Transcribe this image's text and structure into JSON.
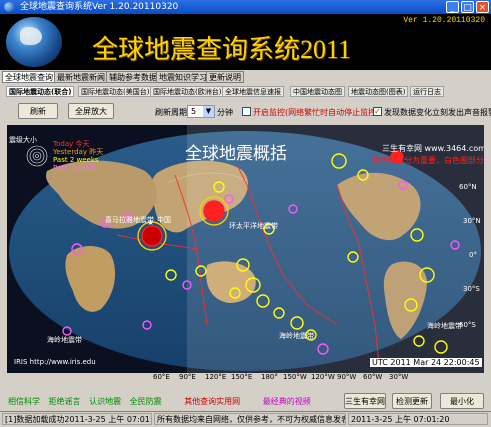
{
  "window": {
    "title": "全球地震查询系统Ver 1.20.20110320",
    "minimize": "_",
    "maximize": "□",
    "close": "×"
  },
  "banner": {
    "title": "全球地震查询系统2011",
    "version": "Ver 1.20.20110320"
  },
  "main_tabs": [
    "全球地震查询",
    "最新地震新闻",
    "辅助参考数据",
    "地震知识学习",
    "更新说明"
  ],
  "sub_tabs": [
    "国际地震动态(联合)",
    "国际地震动态(美国台)",
    "国际地震动态(欧洲台)",
    "全球地震信息速报",
    "中国地震动态图",
    "地震动态图(图表)",
    "运行日志"
  ],
  "toolbar": {
    "refresh": "刷新",
    "fullscreen": "全屏放大",
    "refresh_period_label": "刷新周期",
    "refresh_period_value": "5",
    "refresh_period_unit": "分钟",
    "monitor_label": "开启监控(网络繁忙时自动停止监控)",
    "monitor_checked": false,
    "alarm_label": "发现数据变化立刻发出声音报警",
    "alarm_checked": true
  },
  "map": {
    "title": "全球地震概括",
    "site": "三生有幸网 www.3464.com",
    "note": "黄色圈部分为重要，白色圈部分为白天",
    "legend_size_label": "震级大小",
    "legend": [
      {
        "label": "Today 今天",
        "color": "#ff3030"
      },
      {
        "label": "Yesterday 昨天",
        "color": "#ff9c00"
      },
      {
        "label": "Past 2 weeks",
        "color": "#ffff00"
      },
      {
        "label": "Past 5 years",
        "color": "#ff66ff"
      }
    ],
    "labels": {
      "china": "中国",
      "pacific": "环太平洋地震带",
      "mid_asia": "喜马拉雅地震带",
      "ocean_ridge_1": "海岭地震带",
      "ocean_ridge_2": "海岭地震带",
      "ocean_ridge_3": "海岭地震带"
    },
    "lat_labels": [
      "60°N",
      "30°N",
      "0°",
      "30°S",
      "60°S"
    ],
    "iris": "IRIS  http://www.iris.edu",
    "utc": "UTC 2011 Mar 24 22:00:45",
    "colors": {
      "today": "#ff2020",
      "week": "#ffff00",
      "years": "#ff55ff",
      "important": "#ffcc00"
    }
  },
  "lon_labels": [
    "60°E",
    "90°E",
    "120°E",
    "150°E",
    "180°",
    "150°W",
    "120°W",
    "90°W",
    "60°W",
    "30°W"
  ],
  "bottom_links": [
    {
      "label": "相信科学",
      "color": "#008800"
    },
    {
      "label": "拒绝谣言",
      "color": "#008800"
    },
    {
      "label": "认识地震",
      "color": "#008800"
    },
    {
      "label": "全民防震",
      "color": "#008800"
    },
    {
      "label": "其他查询实用网",
      "color": "#cc0000"
    },
    {
      "label": "最经典的视频",
      "color": "#cc00cc"
    }
  ],
  "bottom_buttons": [
    "三生有幸网",
    "检测更新",
    "最小化"
  ],
  "status": [
    "[1]数据加载成功2011-3-25 上午 07:01:13",
    "所有数据均来自网络，仅供参考，不可为权威信息发表",
    "2011-3-25 上午 07:01:20"
  ]
}
